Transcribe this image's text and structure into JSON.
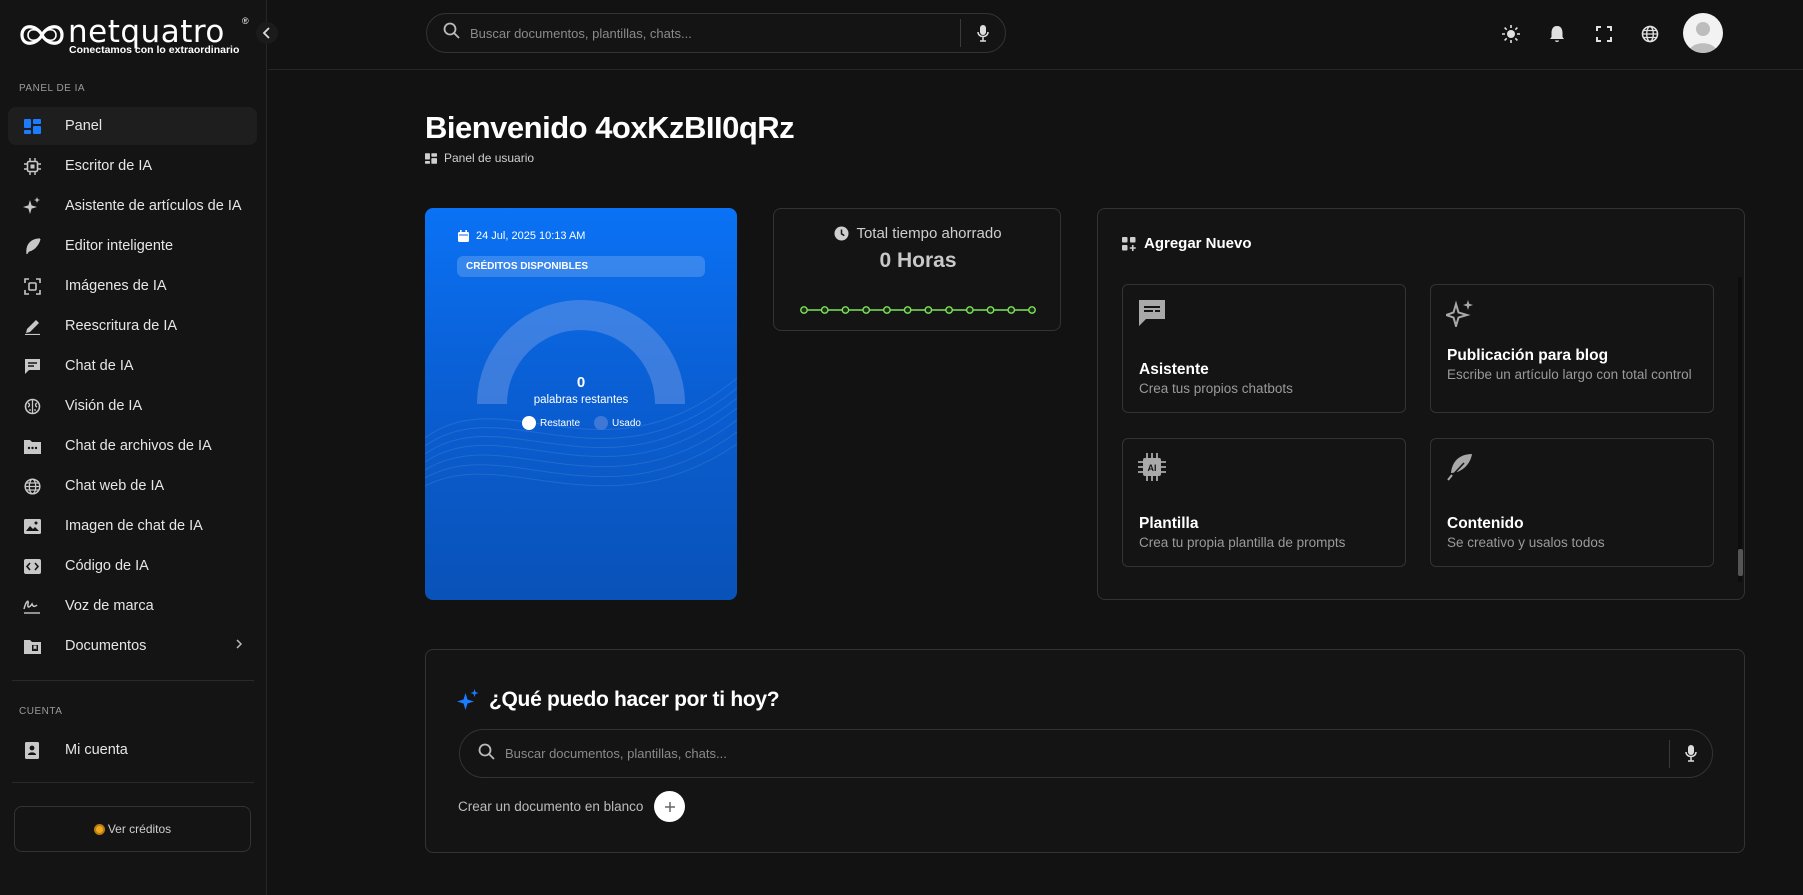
{
  "brand": {
    "name": "netquatro",
    "registered": "®",
    "tagline": "Conectamos con lo extraordinario"
  },
  "sidebar": {
    "section_ai": "PANEL DE IA",
    "items": [
      {
        "label": "Panel",
        "icon": "dashboard-icon",
        "active": true
      },
      {
        "label": "Escritor de IA",
        "icon": "chip-icon"
      },
      {
        "label": "Asistente de artículos de IA",
        "icon": "sparkle-icon"
      },
      {
        "label": "Editor inteligente",
        "icon": "feather-icon"
      },
      {
        "label": "Imágenes de IA",
        "icon": "image-scan-icon"
      },
      {
        "label": "Reescritura de IA",
        "icon": "pen-icon"
      },
      {
        "label": "Chat de IA",
        "icon": "chat-icon"
      },
      {
        "label": "Visión de IA",
        "icon": "brain-icon"
      },
      {
        "label": "Chat de archivos de IA",
        "icon": "file-chat-icon"
      },
      {
        "label": "Chat web de IA",
        "icon": "globe-icon"
      },
      {
        "label": "Imagen de chat de IA",
        "icon": "photo-icon"
      },
      {
        "label": "Código de IA",
        "icon": "code-icon"
      },
      {
        "label": "Voz de marca",
        "icon": "signature-icon"
      },
      {
        "label": "Documentos",
        "icon": "folder-icon",
        "has_children": true
      }
    ],
    "section_account": "CUENTA",
    "account_items": [
      {
        "label": "Mi cuenta",
        "icon": "contact-card-icon"
      }
    ],
    "credits_button": "Ver créditos"
  },
  "topbar": {
    "search_placeholder": "Buscar documentos, plantillas, chats..."
  },
  "page": {
    "welcome": "Bienvenido 4oxKzBII0qRz",
    "breadcrumb": "Panel de usuario"
  },
  "credits_card": {
    "date": "24 Jul, 2025 10:13 AM",
    "badge": "CRÉDITOS DISPONIBLES",
    "value": "0",
    "value_label": "palabras restantes",
    "remaining_fraction": 0,
    "legend_remaining": "Restante",
    "legend_used": "Usado"
  },
  "time_card": {
    "title": "Total tiempo ahorrado",
    "value": "0 Horas",
    "points": [
      0,
      0,
      0,
      0,
      0,
      0,
      0,
      0,
      0,
      0,
      0,
      0
    ]
  },
  "add_new": {
    "title": "Agregar Nuevo",
    "tiles": [
      {
        "title": "Asistente",
        "desc": "Crea tus propios chatbots",
        "icon": "chat-bubble-icon"
      },
      {
        "title": "Publicación para blog",
        "desc": "Escribe un artículo largo con total control",
        "icon": "sparkle-icon"
      },
      {
        "title": "Plantilla",
        "desc": "Crea tu propia plantilla de prompts",
        "icon": "ai-chip-icon"
      },
      {
        "title": "Contenido",
        "desc": "Se creativo y usalos todos",
        "icon": "feather-icon"
      }
    ]
  },
  "prompt": {
    "title": "¿Qué puedo hacer por ti hoy?",
    "search_placeholder": "Buscar documentos, plantillas, chats...",
    "blank_doc": "Crear un documento en blanco"
  },
  "colors": {
    "accent": "#1b7cff",
    "card_blue": "#0a72f5",
    "sparkline": "#7ee35a",
    "background": "#121212"
  }
}
